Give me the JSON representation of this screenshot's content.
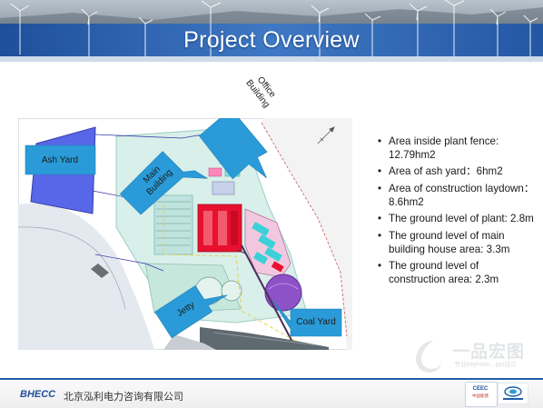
{
  "slide": {
    "title": "Project Overview",
    "bullets": [
      "Area inside plant fence: 12.79hm2",
      "Area of ash yard：6hm2",
      "Area of construction laydown：8.6hm2",
      "The ground level of plant: 2.8m",
      "The ground level of main building house area: 3.3m",
      "The ground level of construction area: 2.3m"
    ]
  },
  "map": {
    "callouts": {
      "ash_yard": "Ash Yard",
      "office_building": [
        "Office",
        "Building"
      ],
      "main_building": [
        "Main",
        "Building"
      ],
      "jetty": "Jetty",
      "coal_yard": "Coal Yard"
    },
    "colors": {
      "callout_fill": "#2a9bd8",
      "ash_yard": "#5867e8",
      "sea": "#e6ebf1",
      "site": "#d6efea",
      "main_building": "#e8102f"
    }
  },
  "footer": {
    "brand": "BHECC",
    "company": "北京泓利电力咨询有限公司",
    "logo_text": "CEEC",
    "logo_sub": "中国能建"
  },
  "watermark": {
    "text": "一品宏图",
    "sub": "专业keynote、ppt设计"
  },
  "theme": {
    "header_blue": "#2a5ca8",
    "accent_blue": "#1f5ea8",
    "text": "#1a1a1a"
  }
}
